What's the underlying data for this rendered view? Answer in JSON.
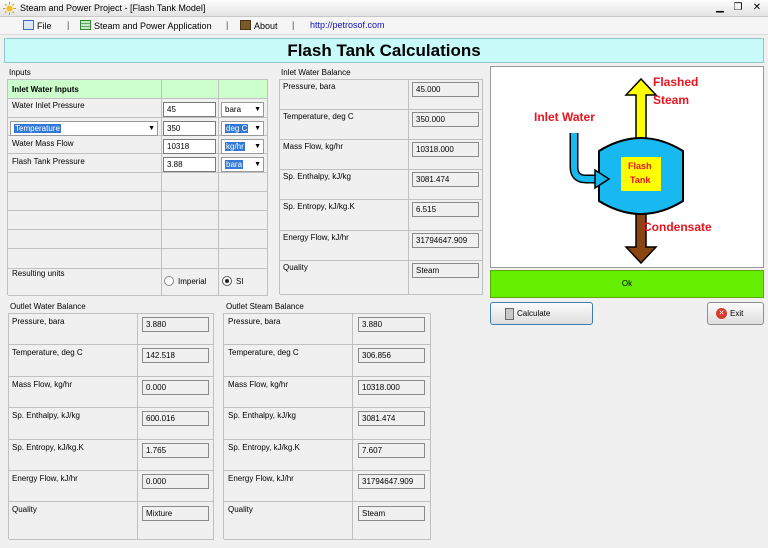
{
  "window": {
    "title": "Steam and Power Project - [Flash Tank Model]"
  },
  "menu": {
    "file": "File",
    "separator": "|",
    "app": "Steam and Power Application",
    "about": "About",
    "link": "http://petrosof.com"
  },
  "header": {
    "title": "Flash Tank Calculations"
  },
  "inputs": {
    "group_label": "Inputs",
    "section_title": "Inlet Water Inputs",
    "rows": [
      {
        "label": "Water Inlet Pressure",
        "value": "45",
        "unit": "bara"
      },
      {
        "label": "Temperature",
        "value": "350",
        "unit": "deg C"
      },
      {
        "label": "Water Mass Flow",
        "value": "10318",
        "unit": "kg/hr"
      },
      {
        "label": "Flash Tank Pressure",
        "value": "3.88",
        "unit": "bara"
      }
    ],
    "resulting_units_label": "Resulting units",
    "radio_imperial": "Imperial",
    "radio_si": "SI",
    "selected_units": "SI"
  },
  "inlet_balance": {
    "group_label": "Inlet Water Balance",
    "rows": [
      {
        "label": "Pressure, bara",
        "value": "45.000"
      },
      {
        "label": "Temperature, deg C",
        "value": "350.000"
      },
      {
        "label": "Mass Flow, kg/hr",
        "value": "10318.000"
      },
      {
        "label": "Sp. Enthalpy, kJ/kg",
        "value": "3081.474"
      },
      {
        "label": "Sp. Entropy, kJ/kg.K",
        "value": "6.515"
      },
      {
        "label": "Energy Flow, kJ/hr",
        "value": "31794647.909"
      },
      {
        "label": "Quality",
        "value": "Steam"
      }
    ]
  },
  "diagram": {
    "flashed_steam": "Flashed",
    "flashed_steam_2": "Steam",
    "inlet_water": "Inlet Water",
    "tank_label_1": "Flash",
    "tank_label_2": "Tank",
    "condensate": "Condensate"
  },
  "status": {
    "text": "Ok",
    "color": "#66ee00"
  },
  "buttons": {
    "calculate": "Calculate",
    "exit": "Exit"
  },
  "outlet_water": {
    "group_label": "Outlet Water Balance",
    "rows": [
      {
        "label": "Pressure, bara",
        "value": "3.880"
      },
      {
        "label": "Temperature, deg C",
        "value": "142.518"
      },
      {
        "label": "Mass Flow, kg/hr",
        "value": "0.000"
      },
      {
        "label": "Sp. Enthalpy, kJ/kg",
        "value": "600.016"
      },
      {
        "label": "Sp. Entropy, kJ/kg.K",
        "value": "1.765"
      },
      {
        "label": "Energy Flow, kJ/hr",
        "value": "0.000"
      },
      {
        "label": "Quality",
        "value": "Mixture"
      }
    ]
  },
  "outlet_steam": {
    "group_label": "Outlet Steam Balance",
    "rows": [
      {
        "label": "Pressure, bara",
        "value": "3.880"
      },
      {
        "label": "Temperature, deg C",
        "value": "306.856"
      },
      {
        "label": "Mass Flow, kg/hr",
        "value": "10318.000"
      },
      {
        "label": "Sp. Enthalpy, kJ/kg",
        "value": "3081.474"
      },
      {
        "label": "Sp. Entropy, kJ/kg.K",
        "value": "7.607"
      },
      {
        "label": "Energy Flow, kJ/hr",
        "value": "31794647.909"
      },
      {
        "label": "Quality",
        "value": "Steam"
      }
    ]
  },
  "colors": {
    "header_bg": "#c8fafa",
    "section_bg": "#ccffcc",
    "tank_fill": "#18b8f0",
    "steam_arrow": "#ffff00",
    "condensate_arrow": "#8b4513",
    "label_red": "#e8141e"
  }
}
